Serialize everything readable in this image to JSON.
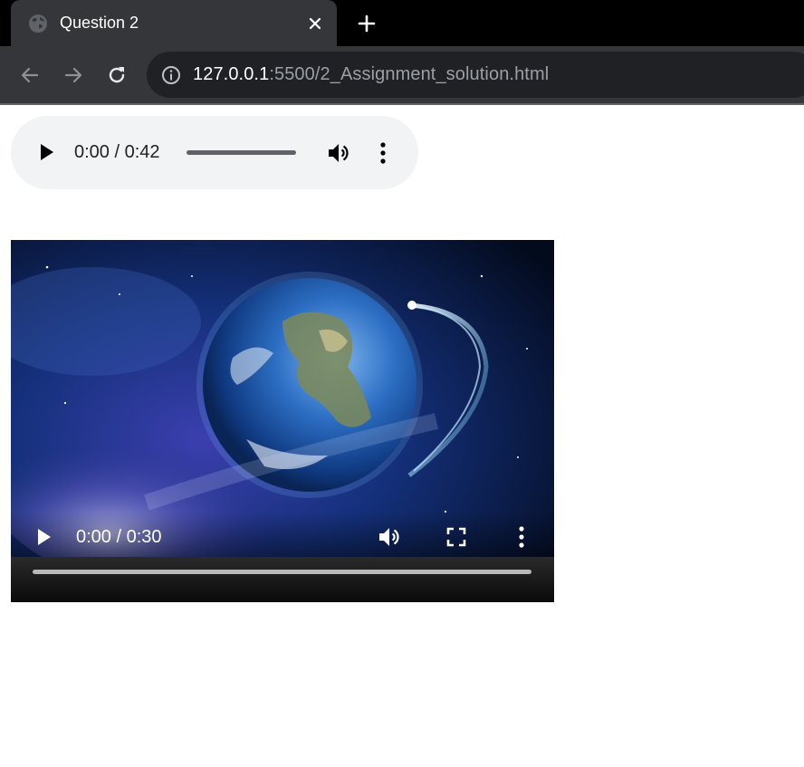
{
  "tab": {
    "title": "Question 2",
    "favicon_icon": "globe-icon",
    "close_icon": "close-icon"
  },
  "new_tab_icon": "plus-icon",
  "toolbar": {
    "back_icon": "arrow-left-icon",
    "forward_icon": "arrow-right-icon",
    "reload_icon": "reload-icon",
    "info_icon": "info-icon",
    "url_host": "127.0.0.1",
    "url_rest": ":5500/2_Assignment_solution.html"
  },
  "audio_player": {
    "time": "0:00 / 0:42",
    "progress": 0,
    "play_icon": "play-icon",
    "volume_icon": "volume-icon",
    "more_icon": "more-vertical-icon"
  },
  "video_player": {
    "time": "0:00 / 0:30",
    "progress": 0,
    "play_icon": "play-icon",
    "volume_icon": "volume-icon",
    "fullscreen_icon": "fullscreen-icon",
    "more_icon": "more-vertical-icon"
  },
  "colors": {
    "tab_strip": "#000000",
    "toolbar": "#35363a",
    "omnibox": "#202124",
    "audio_bg": "#f1f3f4"
  }
}
